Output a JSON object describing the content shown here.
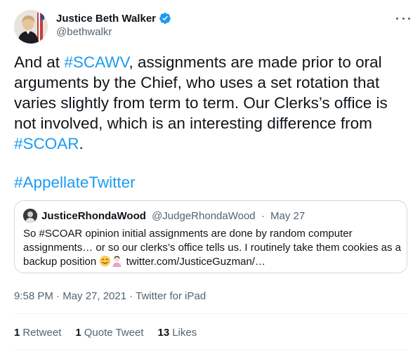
{
  "author": {
    "display_name": "Justice Beth Walker",
    "handle": "@bethwalkr",
    "avatar_icon": "judge-portrait-icon",
    "verified_color": "#1d9bf0"
  },
  "tweet": {
    "line1_pre": "And at ",
    "line1_tag": "#SCAWV",
    "line1_post": ", assignments are made prior to oral arguments by the Chief, who uses a set rotation that varies slightly from term to term.  Our Clerks’s office is not involved, which is an interesting difference from ",
    "line1_tag2": "#SCOAR",
    "line1_end": ".",
    "hashtag": "#AppellateTwitter"
  },
  "quote": {
    "name": "JusticeRhondaWood",
    "handle": "@JudgeRhondaWood",
    "separator": "·",
    "date": "May 27",
    "text": "So #SCOAR opinion initial assignments are done by random computer assignments… or so our clerks’s office tells us. I routinely take them cookies as a backup position ",
    "link": "twitter.com/JusticeGuzman/…"
  },
  "meta": {
    "timestamp": "9:58 PM · May 27, 2021 · Twitter for iPad"
  },
  "stats": {
    "retweets_count": "1",
    "retweets_label": "Retweet",
    "quotes_count": "1",
    "quotes_label": "Quote Tweet",
    "likes_count": "13",
    "likes_label": "Likes"
  },
  "colors": {
    "link": "#1d9bf0",
    "muted": "#536471",
    "text": "#0f1419"
  }
}
